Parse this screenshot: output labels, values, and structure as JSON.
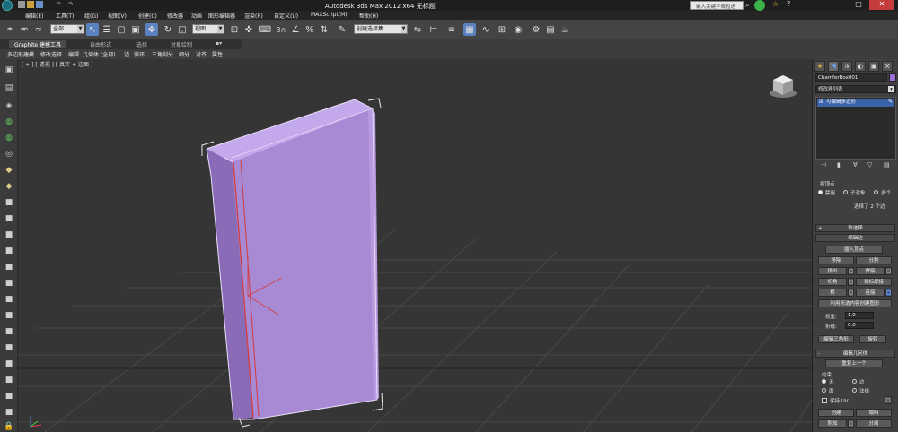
{
  "window": {
    "title": "Autodesk 3ds Max  2012 x64    无标题",
    "search_placeholder": "键入关键字或短语"
  },
  "menu": [
    "编辑(E)",
    "工具(T)",
    "组(G)",
    "视图(V)",
    "创建(C)",
    "修改器",
    "动画",
    "图形编辑器",
    "渲染(R)",
    "自定义(U)",
    "MAXScript(M)",
    "帮助(H)"
  ],
  "toolbar": {
    "selection_filter": "全部",
    "ref_coord": "视图",
    "named_selection": "创建选择集",
    "snap_label": "3"
  },
  "ribbon": {
    "tabs": [
      "Graphite 建模工具",
      "自由形式",
      "选择",
      "对象绘制"
    ],
    "subitems": [
      "多边形建模",
      "修改选择",
      "编辑",
      "几何体 (全部)",
      "边",
      "循环",
      "三角剖分",
      "细分",
      "对齐",
      "属性"
    ]
  },
  "viewport": {
    "label_parts": [
      "+",
      "透视",
      "真实",
      "边面"
    ],
    "colors": {
      "box_face": "#a98bd4",
      "box_side": "#8a6bb8",
      "box_top": "#c4a8ec",
      "grid": "#4d4d4d",
      "edge_selected": "#d23c3c"
    }
  },
  "command_panel": {
    "object_name": "ChamferBox001",
    "object_color": "#9b6fd6",
    "modifier_list": "修改器列表",
    "stack_item": "可编辑多边形",
    "selection": {
      "title": "按顶点",
      "opt_disable": "禁用",
      "opt_subobj": "子对象",
      "opt_multi": "多个",
      "status": "选择了 2 个边"
    },
    "soft_select": "软选择",
    "edit_edges": {
      "title": "编辑边",
      "insert_vertex": "插入顶点",
      "remove": "移除",
      "split": "分割",
      "extrude": "挤出",
      "weld": "焊接",
      "chamfer": "切角",
      "target_weld": "目标焊接",
      "bridge": "桥",
      "connect": "连接",
      "create_shape": "利用所选内容创建图形",
      "weight_label": "权重:",
      "weight_value": "1.0",
      "crease_label": "折缝:",
      "crease_value": "0.0",
      "edit_tri": "编辑三角形",
      "turn": "旋转"
    },
    "edit_geometry": {
      "title": "编辑几何体",
      "repeat_last": "重复上一个",
      "constraints_label": "约束",
      "none": "无",
      "edge": "边",
      "face": "面",
      "normal": "法线",
      "preserve_uv": "保持 UV",
      "create": "创建",
      "collapse": "塌陷",
      "attach": "附加",
      "detach": "分离"
    }
  }
}
